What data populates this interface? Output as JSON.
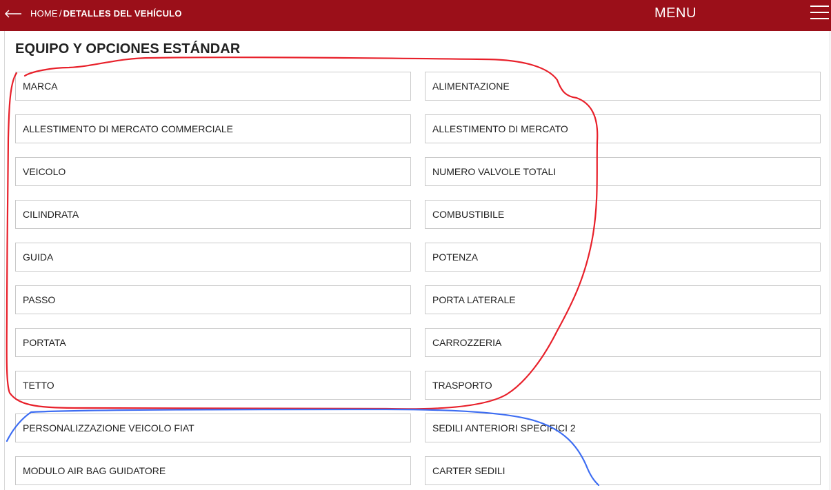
{
  "header": {
    "home_label": "HOME",
    "separator": "/",
    "current_label": "DETALLES DEL VEHÍCULO",
    "menu_label": "MENU",
    "brand_color": "#9b0f19",
    "back_icon": "arrow-left-icon",
    "menu_icon": "hamburger-icon"
  },
  "section": {
    "title": "EQUIPO Y OPCIONES ESTÁNDAR"
  },
  "options": [
    "MARCA",
    "ALIMENTAZIONE",
    "ALLESTIMENTO DI MERCATO COMMERCIALE",
    "ALLESTIMENTO DI MERCATO",
    "VEICOLO",
    "NUMERO VALVOLE TOTALI",
    "CILINDRATA",
    "COMBUSTIBILE",
    "GUIDA",
    "POTENZA",
    "PASSO",
    "PORTA LATERALE",
    "PORTATA",
    "CARROZZERIA",
    "TETTO",
    "TRASPORTO",
    "PERSONALIZZAZIONE VEICOLO FIAT",
    "SEDILI ANTERIORI SPECIFICI 2",
    "MODULO AIR BAG GUIDATORE",
    "CARTER SEDILI"
  ],
  "annotations": {
    "red_color": "#e8202a",
    "blue_color": "#3d6df2"
  }
}
